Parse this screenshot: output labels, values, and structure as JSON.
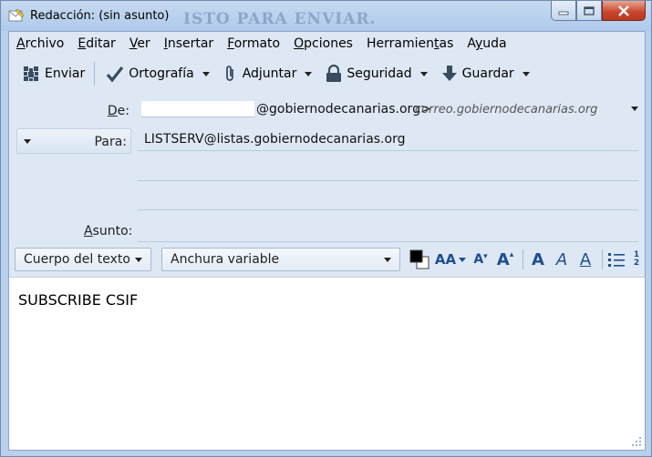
{
  "window": {
    "title": "Redacción: (sin asunto)",
    "ghost_text": "ISTO PARA ENVIAR."
  },
  "menu": [
    {
      "pre": "",
      "ul": "A",
      "post": "rchivo"
    },
    {
      "pre": "",
      "ul": "E",
      "post": "ditar"
    },
    {
      "pre": "",
      "ul": "V",
      "post": "er"
    },
    {
      "pre": "",
      "ul": "I",
      "post": "nsertar"
    },
    {
      "pre": "",
      "ul": "F",
      "post": "ormato"
    },
    {
      "pre": "",
      "ul": "O",
      "post": "pciones"
    },
    {
      "pre": "Herramien",
      "ul": "t",
      "post": "as"
    },
    {
      "pre": "A",
      "ul": "y",
      "post": "uda"
    }
  ],
  "toolbar": {
    "send": "Enviar",
    "spell": "Ortografía",
    "attach": "Adjuntar",
    "security": "Seguridad",
    "save": "Guardar"
  },
  "compose": {
    "from_label_pre": "",
    "from_label_ul": "D",
    "from_label_post": "e:",
    "from_address": "@gobiernodecanarias.org>",
    "from_account": "correo.gobiernodecanarias.org",
    "to_label": "Para:",
    "to_value": "LISTSERV@listas.gobiernodecanarias.org",
    "subject_label_pre": "",
    "subject_label_ul": "A",
    "subject_label_post": "sunto:"
  },
  "format": {
    "paragraph_style": "Cuerpo del texto",
    "font": "Anchura variable",
    "text_color": "#000000",
    "bg_color": "#ffffff"
  },
  "message": {
    "body": "SUBSCRIBE CSIF"
  }
}
